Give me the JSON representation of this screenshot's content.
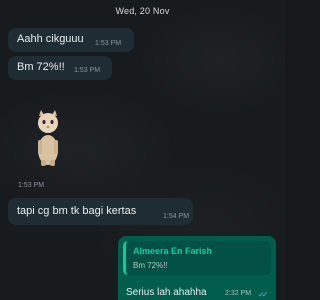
{
  "date_chip": "Wed, 20 Nov",
  "messages": [
    {
      "text": "Aahh cikguuu",
      "time": "1:53 PM"
    },
    {
      "text": "Bm 72%!!",
      "time": "1:53 PM"
    },
    {
      "sticker": "cat-sticker",
      "time": "1:53 PM"
    },
    {
      "text": "tapi cg bm tk bagi kertas",
      "time": "1:54 PM"
    }
  ],
  "reply": {
    "quote_author": "Almeera En Farish",
    "quote_text": "Bm 72%!!",
    "text": "Serius lah ahahha",
    "time": "2:32 PM",
    "status_icon": "double-check-read-icon"
  },
  "colors": {
    "background": "#181b1d",
    "incoming_bubble": "#1f2c33",
    "outgoing_bubble": "#005c4b",
    "quote_accent": "#06cf9c",
    "read_ticks": "#53bdeb"
  }
}
